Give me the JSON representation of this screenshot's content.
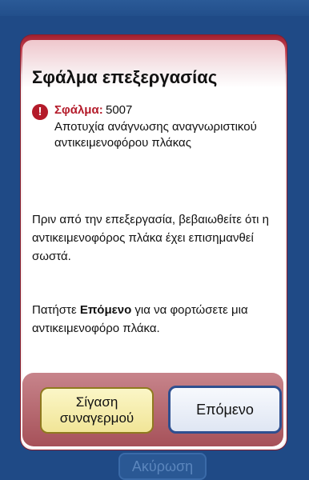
{
  "background": {
    "behind_button_label": "Ακύρωση"
  },
  "dialog": {
    "title": "Σφάλμα επεξεργασίας",
    "error": {
      "icon": "exclamation-circle-icon",
      "label": "Σφάλμα:",
      "code": "5007",
      "description": "Αποτυχία ανάγνωσης αναγνωριστικού αντικειμενοφόρου πλάκας"
    },
    "paragraph1": "Πριν από την επεξεργασία, βεβαιωθείτε ότι η αντικειμενοφόρος πλάκα έχει επισημανθεί σωστά.",
    "paragraph2": {
      "prefix": "Πατήστε ",
      "bold": "Επόμενο",
      "suffix": " για να φορτώσετε μια αντικειμενοφόρο πλάκα."
    },
    "buttons": {
      "silence_alarm_line1": "Σίγαση",
      "silence_alarm_line2": "συναγερμού",
      "next": "Επόμενο"
    }
  },
  "colors": {
    "background": "#1f4a86",
    "error_red": "#b41b2a",
    "silence_button": "#f1e597",
    "next_button_border": "#2e4f90"
  }
}
